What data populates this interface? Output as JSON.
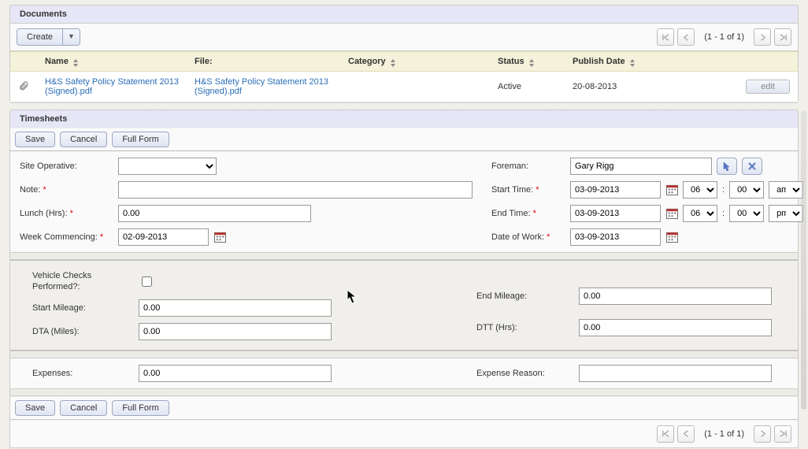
{
  "documents": {
    "title": "Documents",
    "create_label": "Create",
    "pager_text": "(1 - 1 of 1)",
    "columns": {
      "name": "Name",
      "file": "File:",
      "category": "Category",
      "status": "Status",
      "publish": "Publish Date"
    },
    "rows": [
      {
        "name": "H&S Safety Policy Statement 2013 (Signed).pdf",
        "file": "H&S Safety Policy Statement 2013 (Signed).pdf",
        "category": "",
        "status": "Active",
        "publish": "20-08-2013",
        "edit_label": "edit"
      }
    ]
  },
  "timesheets": {
    "title": "Timesheets",
    "save_label": "Save",
    "cancel_label": "Cancel",
    "fullform_label": "Full Form",
    "pager_text": "(1 - 1 of 1)",
    "labels": {
      "site_operative": "Site Operative:",
      "note": "Note:",
      "lunch": "Lunch (Hrs):",
      "week": "Week Commencing:",
      "foreman": "Foreman:",
      "start_time": "Start Time:",
      "end_time": "End Time:",
      "date_of_work": "Date of Work:",
      "vehicle": "Vehicle Checks Performed?:",
      "start_mileage": "Start Mileage:",
      "end_mileage": "End Mileage:",
      "dta": "DTA (Miles):",
      "dtt": "DTT (Hrs):",
      "expenses": "Expenses:",
      "expense_reason": "Expense Reason:"
    },
    "values": {
      "site_operative": "",
      "note": "",
      "lunch": "0.00",
      "week": "02-09-2013",
      "foreman": "Gary Rigg",
      "start_date": "03-09-2013",
      "start_hh": "06",
      "start_mm": "00",
      "start_ampm": "am",
      "end_date": "03-09-2013",
      "end_hh": "06",
      "end_mm": "00",
      "end_ampm": "pm",
      "date_of_work": "03-09-2013",
      "vehicle_checked": false,
      "start_mileage": "0.00",
      "end_mileage": "0.00",
      "dta": "0.00",
      "dtt": "0.00",
      "expenses": "0.00",
      "expense_reason": ""
    },
    "time_sep": ":"
  }
}
